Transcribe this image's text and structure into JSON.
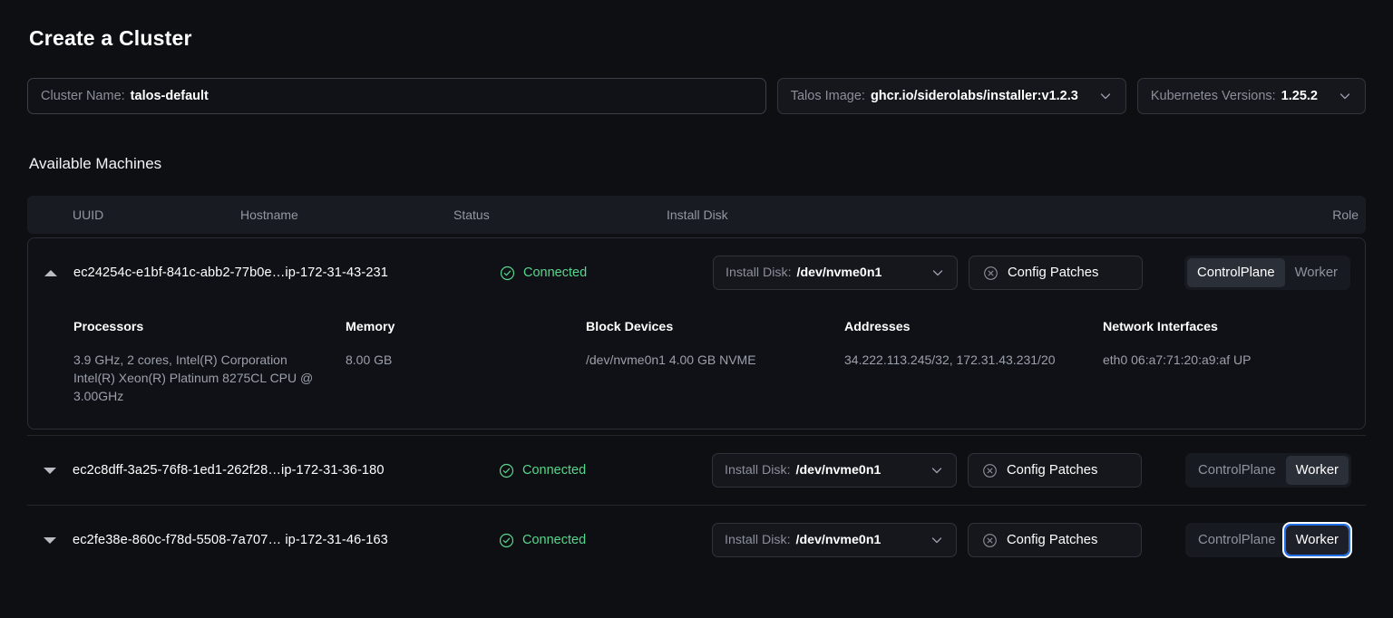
{
  "header": {
    "title": "Create a Cluster"
  },
  "controls": {
    "cluster_name": {
      "label": "Cluster Name:",
      "value": "talos-default"
    },
    "talos_image": {
      "label": "Talos Image:",
      "value": "ghcr.io/siderolabs/installer:v1.2.3"
    },
    "kubernetes_versions": {
      "label": "Kubernetes Versions:",
      "value": "1.25.2"
    }
  },
  "machines_section": {
    "title": "Available Machines",
    "columns": {
      "uuid": "UUID",
      "hostname": "Hostname",
      "status": "Status",
      "install_disk": "Install Disk",
      "role": "Role"
    },
    "role_options": {
      "control_plane": "ControlPlane",
      "worker": "Worker"
    },
    "disk_label": "Install Disk:",
    "config_patches_label": "Config Patches",
    "detail_headings": {
      "processors": "Processors",
      "memory": "Memory",
      "block_devices": "Block Devices",
      "addresses": "Addresses",
      "network_interfaces": "Network Interfaces"
    },
    "rows": [
      {
        "uuid": "ec24254c-e1bf-841c-abb2-77b0e…",
        "hostname": "ip-172-31-43-231",
        "uuid_hostname": "ec24254c-e1bf-841c-abb2-77b0e…ip-172-31-43-231",
        "status": "Connected",
        "install_disk": "/dev/nvme0n1",
        "role_selected": "ControlPlane",
        "expanded": true,
        "details": {
          "processors": "3.9 GHz, 2 cores, Intel(R) Corporation Intel(R) Xeon(R) Platinum 8275CL CPU @ 3.00GHz",
          "memory": "8.00 GB",
          "block_devices": "/dev/nvme0n1 4.00 GB NVME",
          "addresses": "34.222.113.245/32, 172.31.43.231/20",
          "network_interfaces": "eth0 06:a7:71:20:a9:af UP"
        }
      },
      {
        "uuid": "ec2c8dff-3a25-76f8-1ed1-262f28…",
        "hostname": "ip-172-31-36-180",
        "uuid_hostname": "ec2c8dff-3a25-76f8-1ed1-262f28…ip-172-31-36-180",
        "status": "Connected",
        "install_disk": "/dev/nvme0n1",
        "role_selected": "Worker",
        "expanded": false
      },
      {
        "uuid": "ec2fe38e-860c-f78d-5508-7a707…",
        "hostname": "ip-172-31-46-163",
        "uuid_hostname": "ec2fe38e-860c-f78d-5508-7a707… ip-172-31-46-163",
        "status": "Connected",
        "install_disk": "/dev/nvme0n1",
        "role_selected": "Worker",
        "role_focused": "Worker",
        "expanded": false
      }
    ]
  },
  "colors": {
    "background": "#0e0f13",
    "status_connected": "#58d68d",
    "focus_ring": "#1f6feb",
    "accent_text": "#ffffff"
  }
}
